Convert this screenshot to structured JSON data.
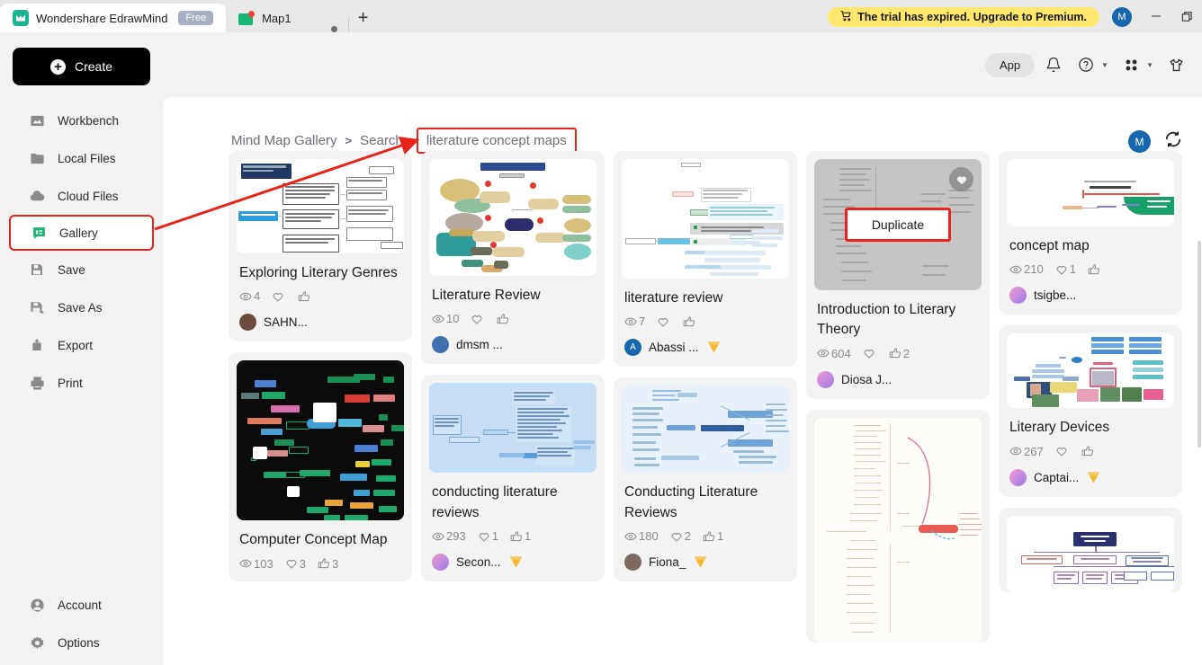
{
  "window": {
    "app_tab_title": "Wondershare EdrawMind",
    "free_badge": "Free",
    "doc_tab_title": "Map1",
    "new_tab_label": "+",
    "trial_notice": "The trial has expired. Upgrade to Premium.",
    "account_initial": "M",
    "minimize_label": "—",
    "restore_label": "❐"
  },
  "sidebar": {
    "create_label": "Create",
    "items": [
      {
        "label": "Workbench",
        "icon": "workbench-icon"
      },
      {
        "label": "Local Files",
        "icon": "folder-icon"
      },
      {
        "label": "Cloud Files",
        "icon": "cloud-icon"
      },
      {
        "label": "Gallery",
        "icon": "gallery-icon",
        "highlighted": true
      },
      {
        "label": "Save",
        "icon": "save-icon"
      },
      {
        "label": "Save As",
        "icon": "save-as-icon"
      },
      {
        "label": "Export",
        "icon": "export-icon"
      },
      {
        "label": "Print",
        "icon": "print-icon"
      }
    ],
    "bottom_items": [
      {
        "label": "Account",
        "icon": "account-icon"
      },
      {
        "label": "Options",
        "icon": "gear-icon"
      }
    ]
  },
  "header": {
    "app_button": "App",
    "icons": [
      {
        "name": "bell-icon"
      },
      {
        "name": "help-circle-icon"
      },
      {
        "name": "apps-grid-icon"
      },
      {
        "name": "shirt-icon"
      }
    ]
  },
  "breadcrumb": {
    "root": "Mind Map Gallery",
    "separator": ">",
    "search_label": "Search:",
    "search_value": "literature concept maps"
  },
  "content_tools": {
    "avatar_initial": "M",
    "refresh_icon": "refresh-icon"
  },
  "cards": [
    {
      "title": "Exploring Literary Genres",
      "views": "4",
      "likes": "",
      "thumbs": "",
      "author": "SAHN...",
      "avatar_color": "#3a3a3a",
      "avatar_initial": "",
      "premium": false,
      "thumb_style": "white-flowchart"
    },
    {
      "title": "Literature Review",
      "views": "10",
      "likes": "",
      "thumbs": "",
      "author": "dmsm ...",
      "avatar_color": "#3f6fae",
      "avatar_initial": "",
      "premium": false,
      "thumb_style": "colorful-bubbles"
    },
    {
      "title": "literature review",
      "views": "7",
      "likes": "",
      "thumbs": "",
      "author": "Abassi ...",
      "avatar_color": "#1667ad",
      "avatar_initial": "A",
      "premium": true,
      "thumb_style": "blue-tree"
    },
    {
      "title": "Introduction to Literary Theory",
      "views": "604",
      "likes": "",
      "thumbs": "2",
      "author": "Diosa J...",
      "avatar_color": "#c37ce0",
      "avatar_initial": "",
      "premium": false,
      "hovered": true,
      "duplicate_label": "Duplicate",
      "thumb_style": "gray-dense"
    },
    {
      "title": "concept map",
      "views": "210",
      "likes": "1",
      "thumbs": "",
      "author": "tsigbe...",
      "avatar_color": "#c37ce0",
      "avatar_initial": "",
      "premium": false,
      "thumb_style": "red-green-sprout"
    },
    {
      "title": "Computer Concept Map",
      "views": "103",
      "likes": "3",
      "thumbs": "3",
      "author": "",
      "avatar_color": "",
      "avatar_initial": "",
      "premium": false,
      "thumb_style": "dark-network"
    },
    {
      "title": "conducting literature reviews",
      "views": "293",
      "likes": "1",
      "thumbs": "1",
      "author": "Secon...",
      "avatar_color": "#c37ce0",
      "avatar_initial": "",
      "premium": true,
      "thumb_style": "lightblue-tree"
    },
    {
      "title": "Conducting Literature Reviews",
      "views": "180",
      "likes": "2",
      "thumbs": "1",
      "author": "Fiona_",
      "avatar_color": "#7a6a60",
      "avatar_initial": "",
      "premium": true,
      "thumb_style": "pale-blue-tree"
    },
    {
      "title": "Literary Devices",
      "views": "267",
      "likes": "",
      "thumbs": "",
      "author": "Captai...",
      "avatar_color": "#e06fa5",
      "avatar_initial": "",
      "premium": true,
      "thumb_style": "images-map"
    },
    {
      "title": "",
      "views": "",
      "likes": "",
      "thumbs": "",
      "author": "",
      "premium": false,
      "thumb_style": "cream-outline"
    },
    {
      "title": "",
      "views": "",
      "likes": "",
      "thumbs": "",
      "author": "",
      "premium": false,
      "thumb_style": "population-genetics-org"
    }
  ],
  "colors": {
    "accent_red": "#e8231c",
    "trial_yellow": "#ffe76b",
    "avatar_blue": "#1667ad",
    "create_black": "#000000",
    "card_bg": "#f3f3f3"
  }
}
